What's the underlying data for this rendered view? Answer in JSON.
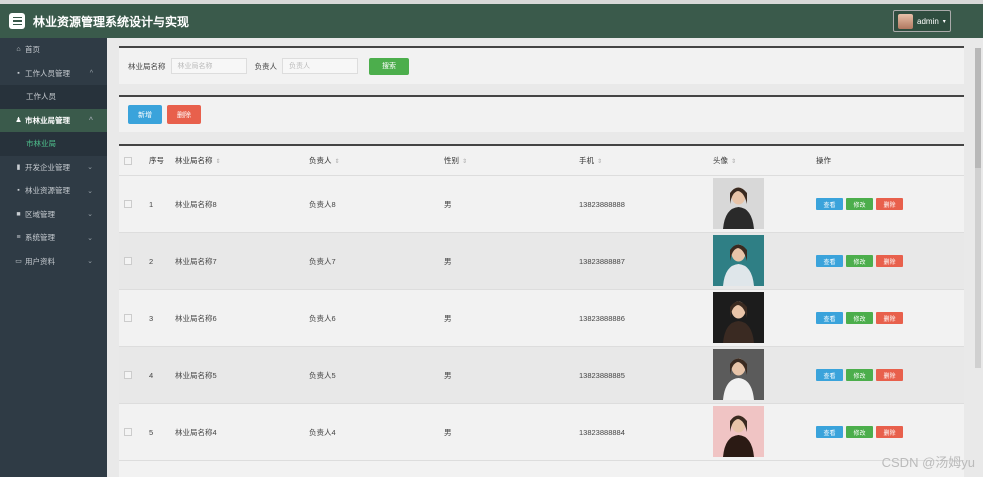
{
  "app": {
    "title": "林业资源管理系统设计与实现",
    "user": "admin"
  },
  "sidebar": {
    "items": [
      {
        "label": "首页",
        "icon": "home-icon",
        "glyph": "⌂"
      },
      {
        "label": "工作人员管理",
        "icon": "grid-icon",
        "glyph": "▪",
        "chev": "^"
      },
      {
        "label": "工作人员",
        "sub": true
      },
      {
        "label": "市林业局管理",
        "icon": "person-icon",
        "glyph": "♟",
        "chev": "^",
        "active": true
      },
      {
        "label": "市林业局",
        "sub": true,
        "active": true
      },
      {
        "label": "开发企业管理",
        "icon": "chart-icon",
        "glyph": "▮",
        "chev": "⌄"
      },
      {
        "label": "林业资源管理",
        "icon": "grid-icon",
        "glyph": "▪",
        "chev": "⌄"
      },
      {
        "label": "区域管理",
        "icon": "block-icon",
        "glyph": "■",
        "chev": "⌄"
      },
      {
        "label": "系统管理",
        "icon": "list-icon",
        "glyph": "≡",
        "chev": "⌄"
      },
      {
        "label": "用户资料",
        "icon": "card-icon",
        "glyph": "▭",
        "chev": "⌄"
      }
    ]
  },
  "search": {
    "label1": "林业局名称",
    "placeholder1": "林业局名称",
    "label2": "负责人",
    "placeholder2": "负责人",
    "button": "搜索"
  },
  "actions": {
    "add": "新增",
    "delete": "删除"
  },
  "table": {
    "headers": {
      "index": "序号",
      "name": "林业局名称",
      "manager": "负责人",
      "gender": "性别",
      "phone": "手机",
      "photo": "头像",
      "ops": "操作"
    },
    "rows": [
      {
        "index": "1",
        "name": "林业局名称8",
        "manager": "负责人8",
        "gender": "男",
        "phone": "13823888888"
      },
      {
        "index": "2",
        "name": "林业局名称7",
        "manager": "负责人7",
        "gender": "男",
        "phone": "13823888887"
      },
      {
        "index": "3",
        "name": "林业局名称6",
        "manager": "负责人6",
        "gender": "男",
        "phone": "13823888886"
      },
      {
        "index": "4",
        "name": "林业局名称5",
        "manager": "负责人5",
        "gender": "男",
        "phone": "13823888885"
      },
      {
        "index": "5",
        "name": "林业局名称4",
        "manager": "负责人4",
        "gender": "男",
        "phone": "13823888884"
      }
    ],
    "op_labels": {
      "view": "查看",
      "edit": "修改",
      "del": "删除"
    }
  },
  "watermark": "CSDN @汤姆yu"
}
